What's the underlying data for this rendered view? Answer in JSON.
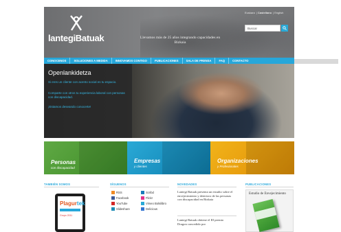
{
  "header": {
    "logo_text": "lantegiBatuak",
    "tagline": "Llevamos más de 25 años integrando capacidades en Bizkaia",
    "languages": [
      "Euskara",
      "Castellano",
      "English"
    ],
    "search": {
      "value": "Buscar"
    }
  },
  "nav": {
    "items": [
      "CONOCENOS",
      "SOLUCIONES A MEDIDA",
      "INNOVAMOS CONTIGO",
      "PUBLICACIONES",
      "SALA DE PRENSA",
      "FAQ",
      "CONTACTO"
    ]
  },
  "hero": {
    "title": "Openlankidetza",
    "p1": "Si eres un cliente con acento social es tu espacio.",
    "p2": "Comparte con otros tu experiencia laboral con personas con discapacidad.",
    "p3": "¡Estamos deseando conocerte!"
  },
  "tiles": [
    {
      "label": "Personas",
      "sub": "con discapacidad"
    },
    {
      "label": "Empresas",
      "sub": "y clientes"
    },
    {
      "label": "Organizaciones",
      "sub": "y Profesionales"
    }
  ],
  "sections": {
    "also": "TAMBIÉN SOMOS",
    "follow": "SÍGUENOS",
    "news": "NOVEDADES",
    "pubs": "PUBLICACIONES"
  },
  "tablet": {
    "brand_a": "Plagur",
    "brand_b": "tek",
    "line": "Grupo 2011"
  },
  "social": {
    "left": [
      "RSS",
      "Facebook",
      "YouTube",
      "Slideshare"
    ],
    "right": [
      "Scribd",
      "Flickr",
      "Vimeo Bolsilibro",
      "Delicious"
    ]
  },
  "news": {
    "item1": "Lantegi Batuak presenta un estudio sobre el envejecimiento y deterioro de las personas con discapacidad en Bizkaia",
    "item2": "Lantegi Batuak obtiene el III premio Dragon concedido por"
  },
  "publication": {
    "title": "Estudio de Envejecimiento"
  },
  "colors": {
    "accent": "#27a7da",
    "green": "#5fa844",
    "orange": "#f1b31a",
    "header": "#77787a"
  }
}
